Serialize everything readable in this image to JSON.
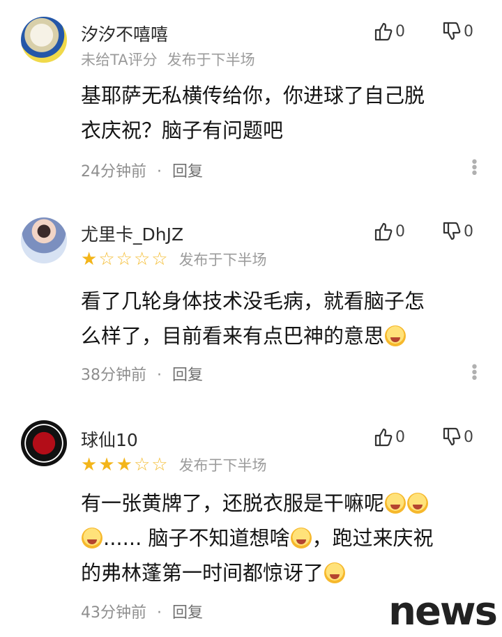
{
  "comments": [
    {
      "username": "汐汐不嘻嘻",
      "rating_text": "未给TA评分",
      "publish": "发布于下半场",
      "content_lines": [
        "基耶萨无私横传给你，你进球了自己脱",
        "衣庆祝？脑子有问题吧"
      ],
      "time": "24分钟前",
      "reply": "回复",
      "likes": "0",
      "dislikes": "0",
      "rating": 0
    },
    {
      "username": "尤里卡_DhJZ",
      "publish": "发布于下半场",
      "content_lines": [
        "看了几轮身体技术没毛病，就看脑子怎",
        "么样了，目前看来有点巴神的意思"
      ],
      "time": "38分钟前",
      "reply": "回复",
      "likes": "0",
      "dislikes": "0",
      "rating": 1
    },
    {
      "username": "球仙10",
      "publish": "发布于下半场",
      "content_lines": [
        "有一张黄牌了，还脱衣服是干嘛呢",
        "...... 脑子不知道想啥",
        "，跑过来庆祝",
        "的弗林蓬第一时间都惊讶了"
      ],
      "time": "43分钟前",
      "reply": "回复",
      "likes": "0",
      "dislikes": "0",
      "rating": 3
    }
  ],
  "separator": "·",
  "watermark": "news",
  "colors": {
    "star": "#f3b51a",
    "meta": "#9b9b9b"
  }
}
